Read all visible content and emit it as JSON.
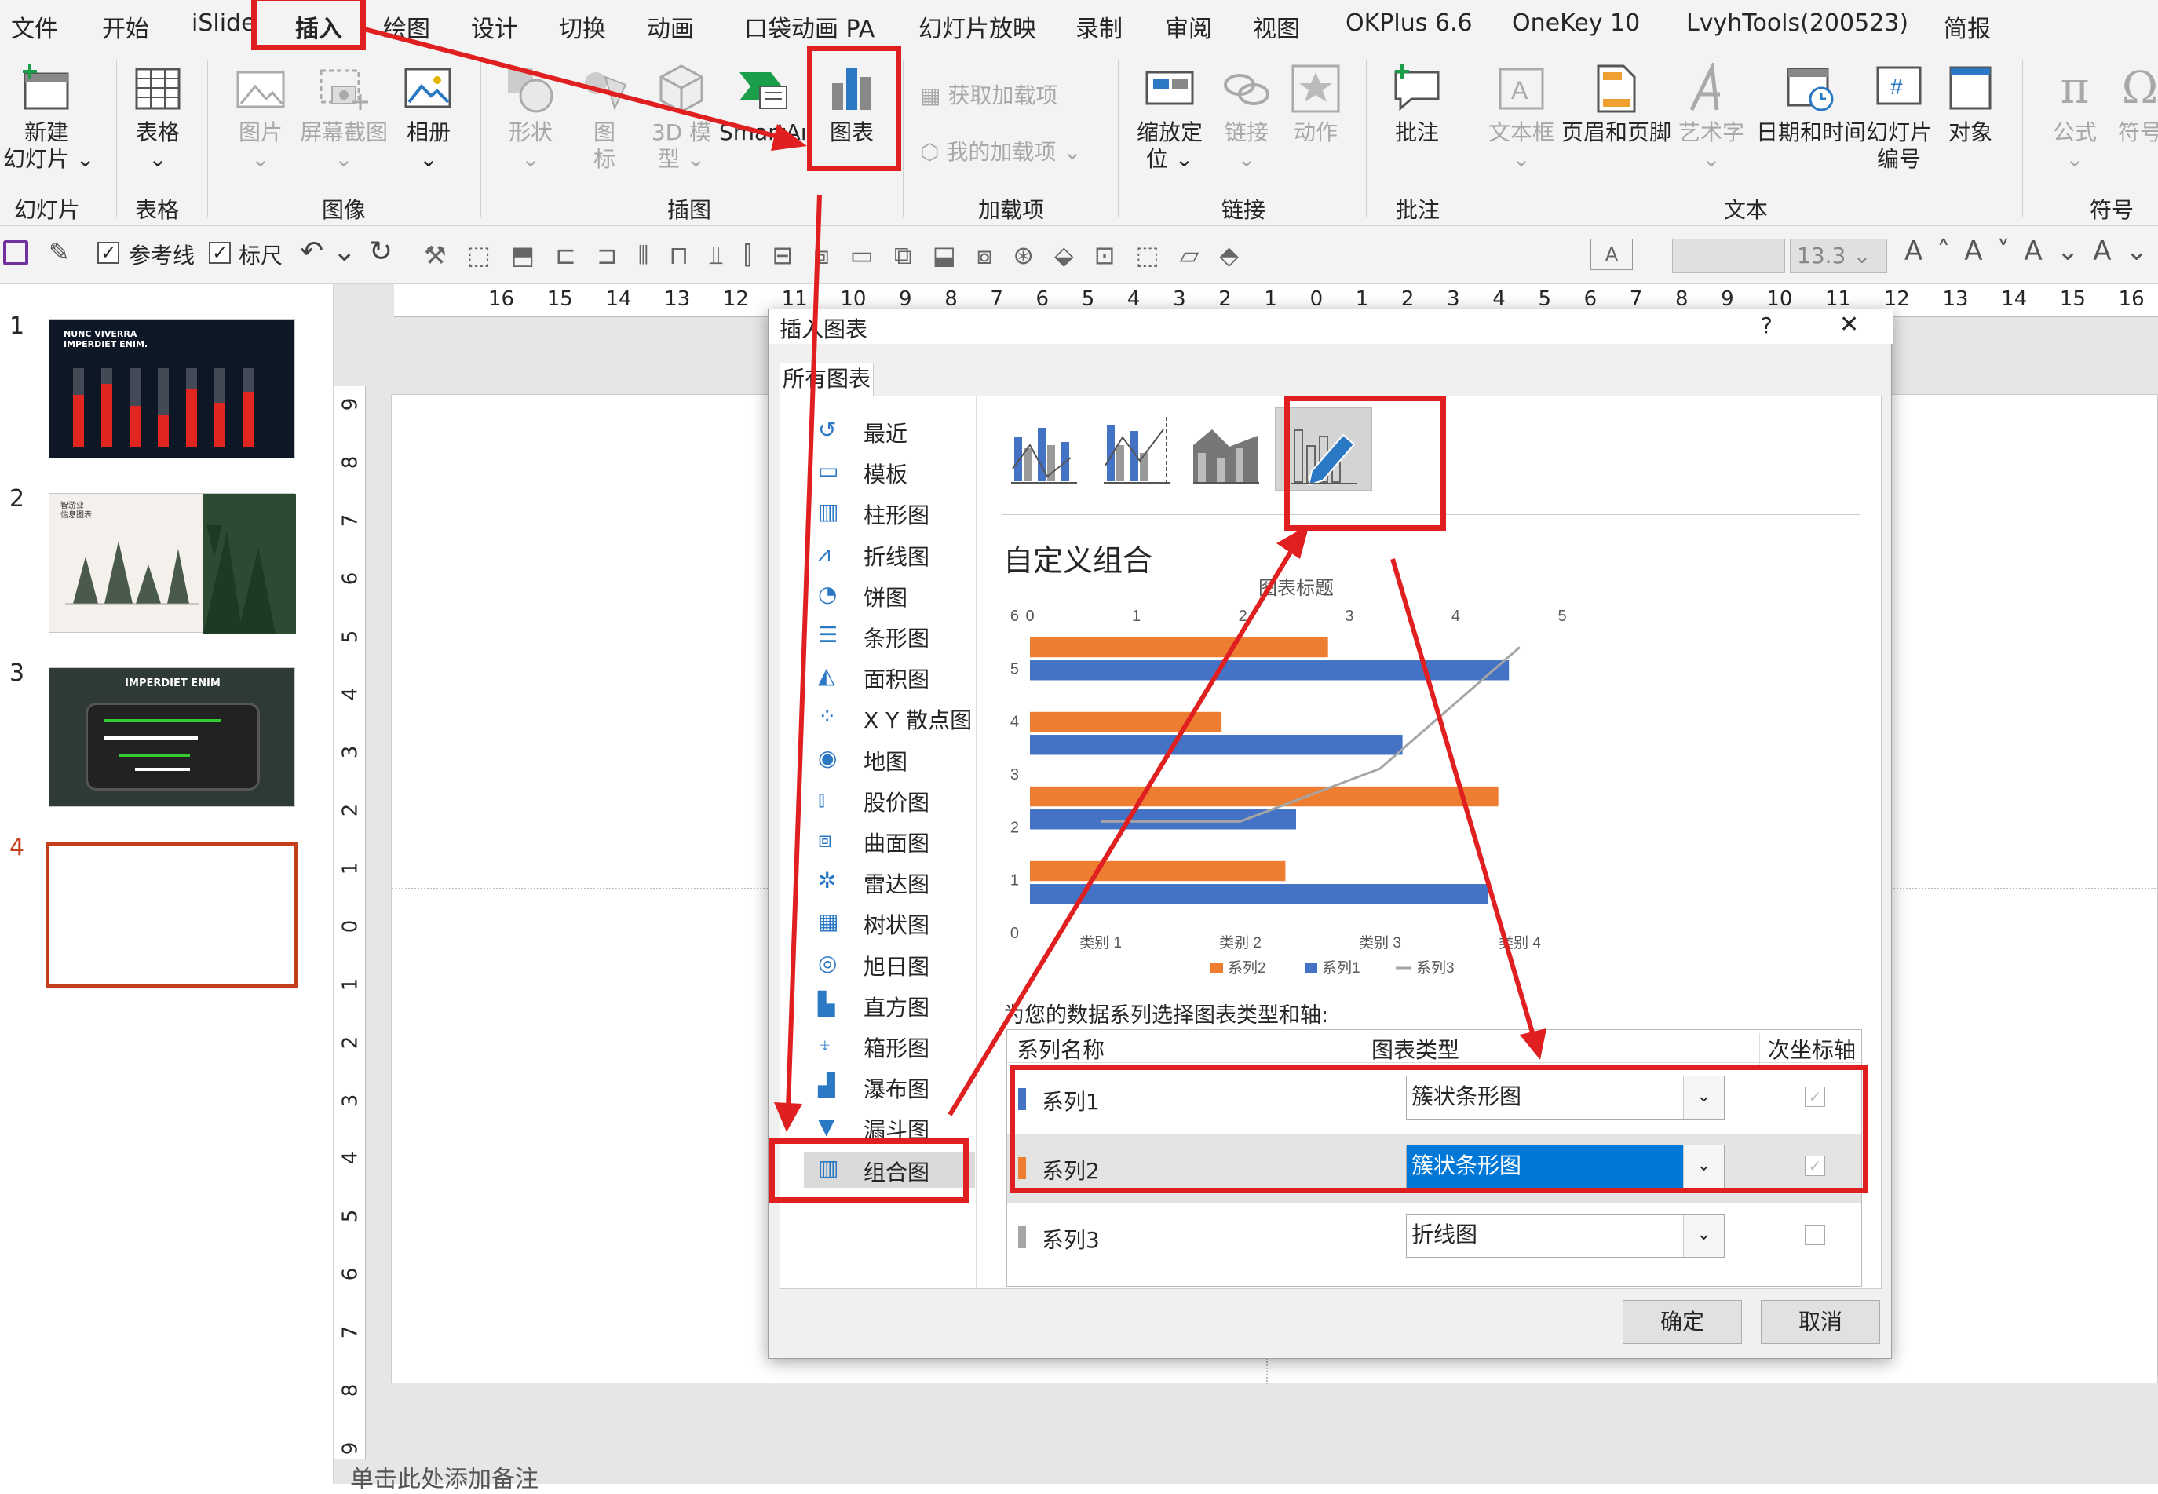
{
  "menu_tabs": [
    "文件",
    "开始",
    "iSlide",
    "插入",
    "绘图",
    "设计",
    "切换",
    "动画",
    "口袋动画 PA",
    "幻灯片放映",
    "录制",
    "审阅",
    "视图",
    "OKPlus 6.6",
    "OneKey 10",
    "LvyhTools(200523)",
    "简报"
  ],
  "ribbon": {
    "new_slide": "新建\n幻灯片 ⌄",
    "table": "表格",
    "picture": "图片",
    "screenshot": "屏幕截图",
    "album": "相册",
    "shapes": "形状",
    "icons": "图\n标",
    "model3d": "3D 模\n型 ⌄",
    "smartart": "SmartArt",
    "chart": "图表",
    "get_addins": "获取加载项",
    "my_addins": "我的加载项",
    "zoom": "缩放定\n位 ⌄",
    "link": "链接",
    "action": "动作",
    "comment": "批注",
    "textbox": "文本框",
    "header_footer": "页眉和页脚",
    "wordart": "艺术字",
    "datetime": "日期和时间",
    "slide_number": "幻灯片\n编号",
    "object": "对象",
    "equation": "公式",
    "symbol": "符号",
    "groups": [
      "幻灯片",
      "表格",
      "图像",
      "插图",
      "加载项",
      "链接",
      "批注",
      "文本",
      "符号"
    ]
  },
  "qat": {
    "guides": "参考线",
    "ruler": "标尺",
    "font_size": "13.3"
  },
  "ruler_top": [
    "16",
    "15",
    "14",
    "13",
    "12",
    "11",
    "10",
    "9",
    "8",
    "7",
    "6",
    "5",
    "4",
    "3",
    "2",
    "1",
    "0",
    "1",
    "2",
    "3",
    "4",
    "5",
    "6",
    "7",
    "8",
    "9",
    "10",
    "11",
    "12",
    "13",
    "14",
    "15",
    "16"
  ],
  "ruler_left": [
    "9",
    "8",
    "7",
    "6",
    "5",
    "4",
    "3",
    "2",
    "1",
    "0",
    "1",
    "2",
    "3",
    "4",
    "5",
    "6",
    "7",
    "8",
    "9"
  ],
  "slides": [
    {
      "num": "1",
      "title": "NUNC VIVERRA\nIMPERDIET ENIM."
    },
    {
      "num": "2",
      "title": "智游业\n信息图表"
    },
    {
      "num": "3",
      "title": "IMPERDIET ENIM"
    },
    {
      "num": "4",
      "title": ""
    }
  ],
  "notes_placeholder": "单击此处添加备注",
  "dialog": {
    "title": "插入图表",
    "help": "?",
    "close": "✕",
    "tab": "所有图表",
    "chart_types": [
      "最近",
      "模板",
      "柱形图",
      "折线图",
      "饼图",
      "条形图",
      "面积图",
      "X Y 散点图",
      "地图",
      "股价图",
      "曲面图",
      "雷达图",
      "树状图",
      "旭日图",
      "直方图",
      "箱形图",
      "瀑布图",
      "漏斗图",
      "组合图"
    ],
    "selected_type": "组合图",
    "subtype_title": "自定义组合",
    "preview_title": "图表标题",
    "series_prompt": "为您的数据系列选择图表类型和轴:",
    "col_series": "系列名称",
    "col_type": "图表类型",
    "col_secondary": "次坐标轴",
    "rows": [
      {
        "name": "系列1",
        "type": "簇状条形图",
        "color": "#4472c4",
        "secondary": true
      },
      {
        "name": "系列2",
        "type": "簇状条形图",
        "color": "#ed7d31",
        "secondary": true
      },
      {
        "name": "系列3",
        "type": "折线图",
        "color": "#a5a5a5",
        "secondary": false
      }
    ],
    "ok": "确定",
    "cancel": "取消"
  },
  "chart_data": {
    "type": "bar",
    "title": "图表标题",
    "categories": [
      "类别 1",
      "类别 2",
      "类别 3",
      "类别 4"
    ],
    "series": [
      {
        "name": "系列1",
        "chart": "clustered bar",
        "values": [
          4.3,
          2.5,
          3.5,
          4.5
        ],
        "color": "#4472c4"
      },
      {
        "name": "系列2",
        "chart": "clustered bar",
        "values": [
          2.4,
          4.4,
          1.8,
          2.8
        ],
        "color": "#ed7d31"
      },
      {
        "name": "系列3",
        "chart": "line",
        "values": [
          2,
          2,
          3,
          5
        ],
        "color": "#a5a5a5"
      }
    ],
    "x_ticks": [
      "0",
      "1",
      "2",
      "3",
      "4",
      "5"
    ],
    "y_ticks": [
      "0",
      "1",
      "2",
      "3",
      "4",
      "5",
      "6"
    ],
    "xlim": [
      0,
      5
    ],
    "ylim": [
      0,
      6
    ],
    "legend": [
      "系列2",
      "系列1",
      "系列3"
    ],
    "legend_position": "bottom",
    "grid": false
  },
  "colors": {
    "highlight": "#e02020",
    "selection": "#0078d7",
    "slide_selected": "#c43e1c"
  }
}
